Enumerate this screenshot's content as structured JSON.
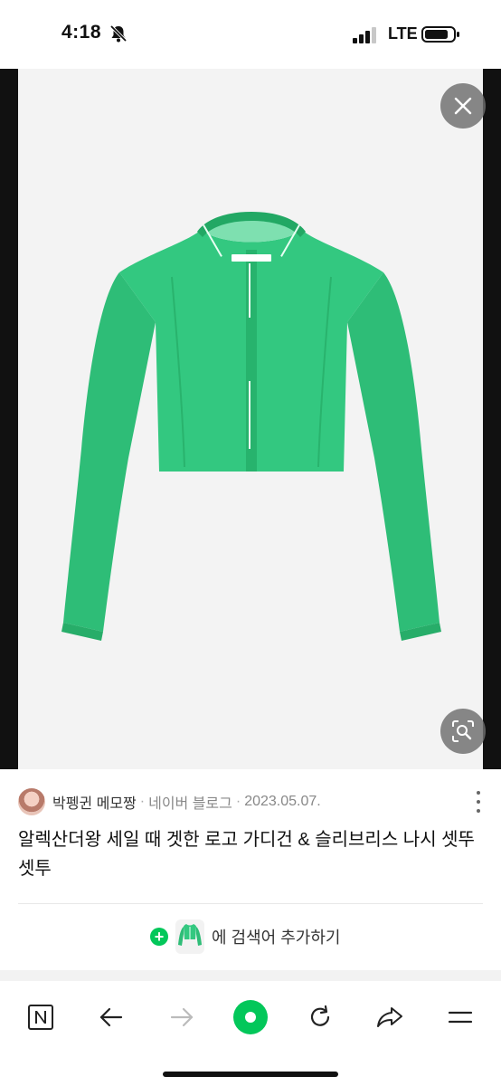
{
  "status_bar": {
    "time": "4:18",
    "network": "LTE",
    "icons": [
      "bell-muted-icon",
      "signal-icon",
      "battery-icon"
    ]
  },
  "viewer": {
    "close_icon": "close-icon",
    "lens_icon": "image-search-icon",
    "jacket_color": "#2fc47e"
  },
  "post": {
    "author": "박펭귄 메모짱",
    "separator": "·",
    "source": "네이버 블로그",
    "date": "2023.05.07.",
    "title": "알렉산더왕 세일 때 겟한 로고 가디건 & 슬리브리스 나시 셋뚜셋투"
  },
  "search_add": {
    "plus": "+",
    "text": "에 검색어 추가하기"
  },
  "toolbar": {
    "items": [
      "naver-n-icon",
      "back-arrow-icon",
      "forward-arrow-icon",
      "green-dot-icon",
      "refresh-icon",
      "share-icon",
      "menu-icon"
    ],
    "n_label": "N"
  },
  "colors": {
    "accent": "#03c75a",
    "overlay_button": "#6e6e6e"
  }
}
